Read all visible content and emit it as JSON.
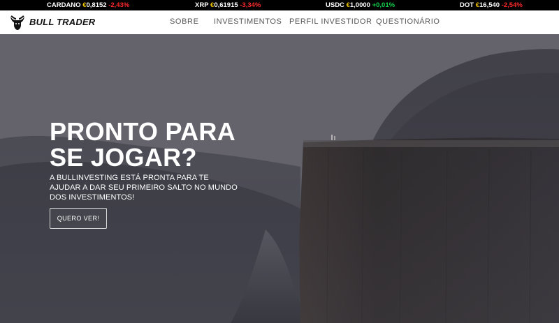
{
  "ticker": [
    {
      "symbol": "CARDANO",
      "currency": "€",
      "price": "0,8152",
      "change": "-2,43%",
      "trend": "neg"
    },
    {
      "symbol": "XRP",
      "currency": "€",
      "price": "0,61915",
      "change": "-3,34%",
      "trend": "neg"
    },
    {
      "symbol": "USDC",
      "currency": "€",
      "price": "1,0000",
      "change": "+0,01%",
      "trend": "pos"
    },
    {
      "symbol": "DOT",
      "currency": "€",
      "price": "16,540",
      "change": "-2,54%",
      "trend": "neg"
    }
  ],
  "brand": {
    "name": "BULL TRADER",
    "logo_icon": "bull-head-icon"
  },
  "nav": {
    "items": [
      "SOBRE",
      "INVESTIMENTOS",
      "PERFIL INVESTIDOR",
      "QUESTIONÁRIO"
    ]
  },
  "hero": {
    "title_line1": "PRONTO PARA",
    "title_line2": "SE JOGAR?",
    "subtitle": "A BULLINVESTING ESTÁ PRONTA PARA TE AJUDAR A DAR SEU PRIMEIRO SALTO NO MUNDO DOS INVESTIMENTOS!",
    "cta_label": "QUERO VER!"
  },
  "colors": {
    "currency": "#f2c200",
    "negative": "#ff2a2a",
    "positive": "#14d24a",
    "nav_text": "#555555"
  }
}
